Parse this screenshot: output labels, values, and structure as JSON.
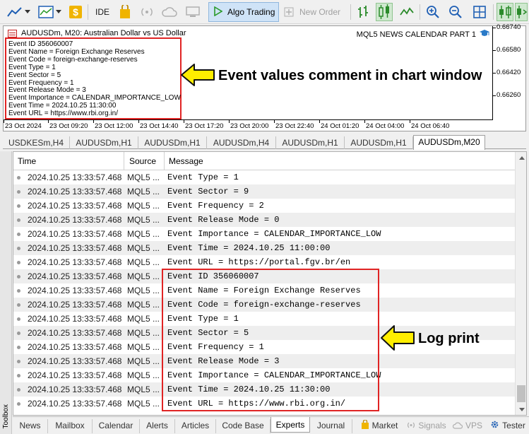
{
  "toolbar": {
    "ide_label": "IDE",
    "algo_label": "Algo Trading",
    "new_order_label": "New Order"
  },
  "chart": {
    "title": "AUDUSDm, M20:  Australian Dollar vs US Dollar",
    "news_label": "MQL5 NEWS CALENDAR PART 1",
    "comment_lines": [
      "Event ID 356060007",
      "Event Name = Foreign Exchange Reserves",
      "Event Code = foreign-exchange-reserves",
      "Event Type = 1",
      "Event Sector = 5",
      "Event Frequency = 1",
      "Event Release Mode = 3",
      "Event Importance = CALENDAR_IMPORTANCE_LOW",
      "Event Time = 2024.10.25 11:30:00",
      "Event URL = https://www.rbi.org.in/"
    ],
    "y_ticks": [
      "0.66740",
      "0.66580",
      "0.66420",
      "0.66260"
    ],
    "x_ticks": [
      "23 Oct 2024",
      "23 Oct 09:20",
      "23 Oct 12:00",
      "23 Oct 14:40",
      "23 Oct 17:20",
      "23 Oct 20:00",
      "23 Oct 22:40",
      "24 Oct 01:20",
      "24 Oct 04:00",
      "24 Oct 06:40"
    ],
    "annotation": "Event values comment in chart window"
  },
  "chart_tabs": [
    "USDKESm,H4",
    "AUDUSDm,H1",
    "AUDUSDm,H1",
    "AUDUSDm,H4",
    "AUDUSDm,H1",
    "AUDUSDm,H1",
    "AUDUSDm,M20"
  ],
  "sidebar_label": "Toolbox",
  "log": {
    "headers": {
      "time": "Time",
      "source": "Source",
      "message": "Message"
    },
    "rows": [
      {
        "time": "2024.10.25 13:33:57.468",
        "source": "MQL5 ...",
        "message": "Event Type = 1"
      },
      {
        "time": "2024.10.25 13:33:57.468",
        "source": "MQL5 ...",
        "message": "Event Sector = 9"
      },
      {
        "time": "2024.10.25 13:33:57.468",
        "source": "MQL5 ...",
        "message": "Event Frequency = 2"
      },
      {
        "time": "2024.10.25 13:33:57.468",
        "source": "MQL5 ...",
        "message": "Event Release Mode = 0"
      },
      {
        "time": "2024.10.25 13:33:57.468",
        "source": "MQL5 ...",
        "message": "Event Importance = CALENDAR_IMPORTANCE_LOW"
      },
      {
        "time": "2024.10.25 13:33:57.468",
        "source": "MQL5 ...",
        "message": "Event Time = 2024.10.25 11:00:00"
      },
      {
        "time": "2024.10.25 13:33:57.468",
        "source": "MQL5 ...",
        "message": "Event URL = https://portal.fgv.br/en"
      },
      {
        "time": "2024.10.25 13:33:57.468",
        "source": "MQL5 ...",
        "message": "Event ID 356060007"
      },
      {
        "time": "2024.10.25 13:33:57.468",
        "source": "MQL5 ...",
        "message": "Event Name = Foreign Exchange Reserves"
      },
      {
        "time": "2024.10.25 13:33:57.468",
        "source": "MQL5 ...",
        "message": "Event Code = foreign-exchange-reserves"
      },
      {
        "time": "2024.10.25 13:33:57.468",
        "source": "MQL5 ...",
        "message": "Event Type = 1"
      },
      {
        "time": "2024.10.25 13:33:57.468",
        "source": "MQL5 ...",
        "message": "Event Sector = 5"
      },
      {
        "time": "2024.10.25 13:33:57.468",
        "source": "MQL5 ...",
        "message": "Event Frequency = 1"
      },
      {
        "time": "2024.10.25 13:33:57.468",
        "source": "MQL5 ...",
        "message": "Event Release Mode = 3"
      },
      {
        "time": "2024.10.25 13:33:57.468",
        "source": "MQL5 ...",
        "message": "Event Importance = CALENDAR_IMPORTANCE_LOW"
      },
      {
        "time": "2024.10.25 13:33:57.468",
        "source": "MQL5 ...",
        "message": "Event Time = 2024.10.25 11:30:00"
      },
      {
        "time": "2024.10.25 13:33:57.468",
        "source": "MQL5 ...",
        "message": "Event URL = https://www.rbi.org.in/"
      }
    ],
    "annotation": "Log print"
  },
  "bottom_tabs": {
    "news": "News",
    "mailbox": "Mailbox",
    "calendar": "Calendar",
    "alerts": "Alerts",
    "articles": "Articles",
    "codebase": "Code Base",
    "experts": "Experts",
    "journal": "Journal",
    "market": "Market",
    "signals": "Signals",
    "vps": "VPS",
    "tester": "Tester"
  },
  "colors": {
    "highlight_red": "#e02424",
    "arrow_yellow": "#ffee00",
    "algo_blue": "#cfe3f7"
  }
}
